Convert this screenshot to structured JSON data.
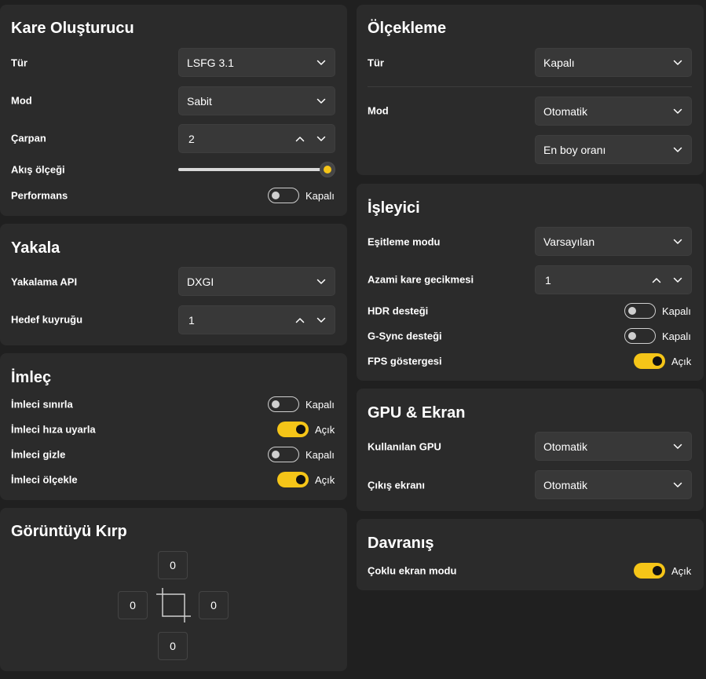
{
  "colors": {
    "accent": "#f5c518",
    "card": "#2b2b2b",
    "background": "#202020"
  },
  "frame_gen": {
    "title": "Kare Oluşturucu",
    "type_label": "Tür",
    "type_value": "LSFG 3.1",
    "mode_label": "Mod",
    "mode_value": "Sabit",
    "multiplier_label": "Çarpan",
    "multiplier_value": "2",
    "flow_label": "Akış ölçeği",
    "flow_level": 1.0,
    "performance_label": "Performans",
    "performance_state": "Kapalı"
  },
  "capture": {
    "title": "Yakala",
    "api_label": "Yakalama API",
    "api_value": "DXGI",
    "queue_label": "Hedef kuyruğu",
    "queue_value": "1"
  },
  "cursor": {
    "title": "İmleç",
    "items": [
      {
        "label": "İmleci sınırla",
        "state": "Kapalı",
        "on": false
      },
      {
        "label": "İmleci hıza uyarla",
        "state": "Açık",
        "on": true
      },
      {
        "label": "İmleci gizle",
        "state": "Kapalı",
        "on": false
      },
      {
        "label": "İmleci ölçekle",
        "state": "Açık",
        "on": true
      }
    ]
  },
  "crop": {
    "title": "Görüntüyü Kırp",
    "top": "0",
    "left": "0",
    "right": "0",
    "bottom": "0"
  },
  "scaling": {
    "title": "Ölçekleme",
    "type_label": "Tür",
    "type_value": "Kapalı",
    "mode_label": "Mod",
    "mode_value": "Otomatik",
    "aspect_value": "En boy oranı"
  },
  "renderer": {
    "title": "İşleyici",
    "sync_label": "Eşitleme modu",
    "sync_value": "Varsayılan",
    "latency_label": "Azami kare gecikmesi",
    "latency_value": "1",
    "hdr_label": "HDR desteği",
    "hdr_state": "Kapalı",
    "gsync_label": "G-Sync desteği",
    "gsync_state": "Kapalı",
    "fps_label": "FPS göstergesi",
    "fps_state": "Açık"
  },
  "gpu": {
    "title": "GPU & Ekran",
    "gpu_label": "Kullanılan GPU",
    "gpu_value": "Otomatik",
    "output_label": "Çıkış ekranı",
    "output_value": "Otomatik"
  },
  "behavior": {
    "title": "Davranış",
    "multi_label": "Çoklu ekran modu",
    "multi_state": "Açık"
  }
}
